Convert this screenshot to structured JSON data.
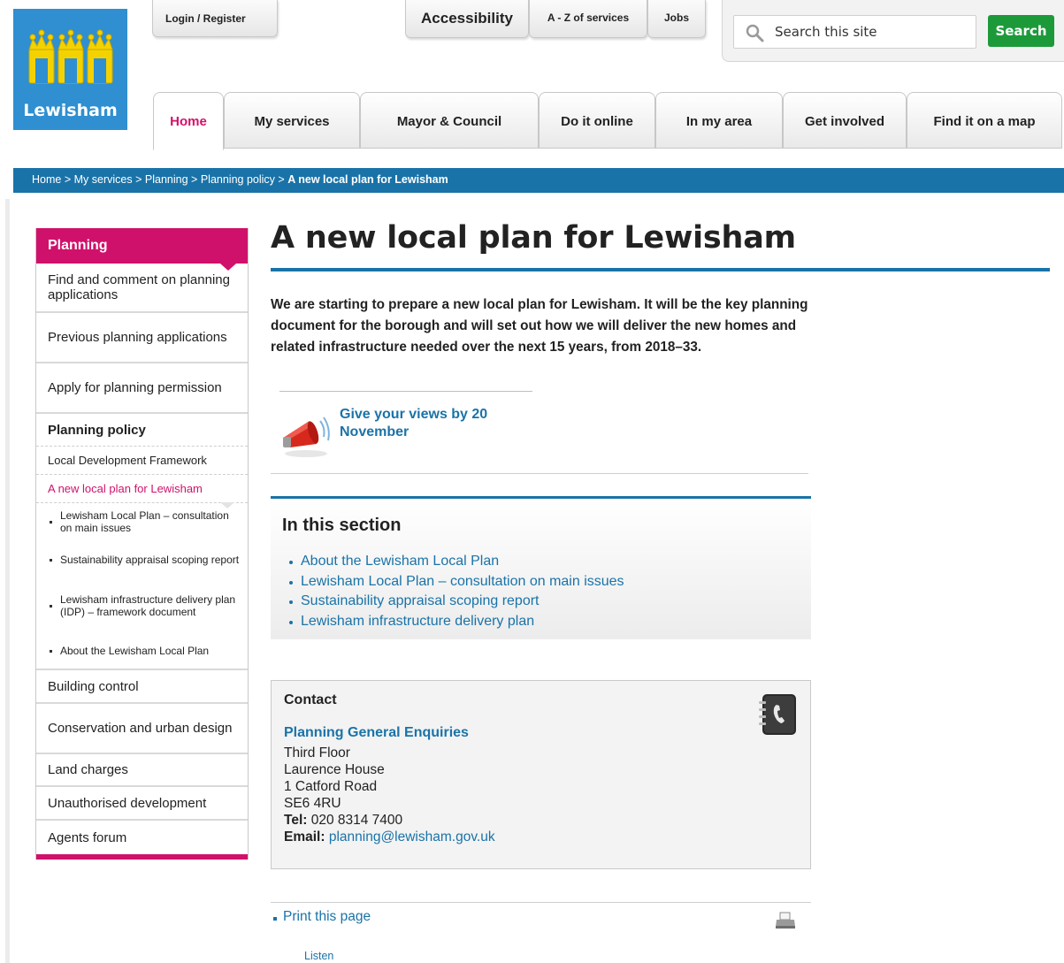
{
  "logo": {
    "text": "Lewisham",
    "bg_color": "#2f8fd0",
    "icon": "crown-icon"
  },
  "top_links": {
    "login": "Login / Register",
    "accessibility": "Accessibility",
    "az": "A - Z of services",
    "jobs": "Jobs"
  },
  "search": {
    "placeholder": "Search this site",
    "button": "Search",
    "button_color": "#1c9a3a",
    "icon": "search-icon"
  },
  "nav": {
    "tabs": [
      {
        "label": "Home",
        "active": true
      },
      {
        "label": "My services"
      },
      {
        "label": "Mayor & Council"
      },
      {
        "label": "Do it online"
      },
      {
        "label": "In my area"
      },
      {
        "label": "Get involved"
      },
      {
        "label": "Find it on a map"
      }
    ]
  },
  "breadcrumb": {
    "items": [
      "Home",
      "My services",
      "Planning",
      "Planning policy"
    ],
    "separator": ">",
    "current": "A new local plan for Lewisham",
    "bg_color": "#1a73a8"
  },
  "sidebar": {
    "heading": "Planning",
    "accent_color": "#d0116b",
    "items": [
      "Find and comment on planning applications",
      "Previous planning applications",
      "Apply for planning permission",
      "Planning policy"
    ],
    "sub_items": [
      "Local Development Framework",
      "A new local plan for Lewisham"
    ],
    "bullets": [
      "Lewisham Local Plan – consultation on main issues",
      "Sustainability appraisal scoping report",
      "Lewisham infrastructure delivery plan (IDP) – framework document",
      "About the Lewisham Local Plan"
    ],
    "bottom_items": [
      "Building control",
      "Conservation and urban design",
      "Land charges",
      "Unauthorised development",
      "Agents forum"
    ]
  },
  "main": {
    "title": "A new local plan for Lewisham",
    "intro": "We are starting to prepare a new local plan for Lewisham. It will be the key planning document for the borough and will set out how we will deliver the new homes and related infrastructure needed over the next 15 years, from 2018–33.",
    "promo": {
      "text": "Give your views by 20 November",
      "icon": "megaphone-icon"
    },
    "in_this_section": {
      "title": "In this section",
      "links": [
        "About the Lewisham Local Plan",
        "Lewisham Local Plan – consultation on main issues",
        "Sustainability appraisal scoping report",
        "Lewisham infrastructure delivery plan"
      ]
    },
    "contact": {
      "title": "Contact",
      "name": "Planning General Enquiries",
      "address": [
        "Third Floor",
        "Laurence House",
        "1 Catford Road",
        "SE6 4RU"
      ],
      "tel_label": "Tel:",
      "tel": "020 8314 7400",
      "email_label": "Email:",
      "email": "planning@lewisham.gov.uk",
      "icon": "phone-book-icon"
    },
    "print": {
      "label": "Print this page",
      "icon": "printer-icon"
    },
    "listen": "Listen",
    "link_color": "#1a73a8"
  }
}
